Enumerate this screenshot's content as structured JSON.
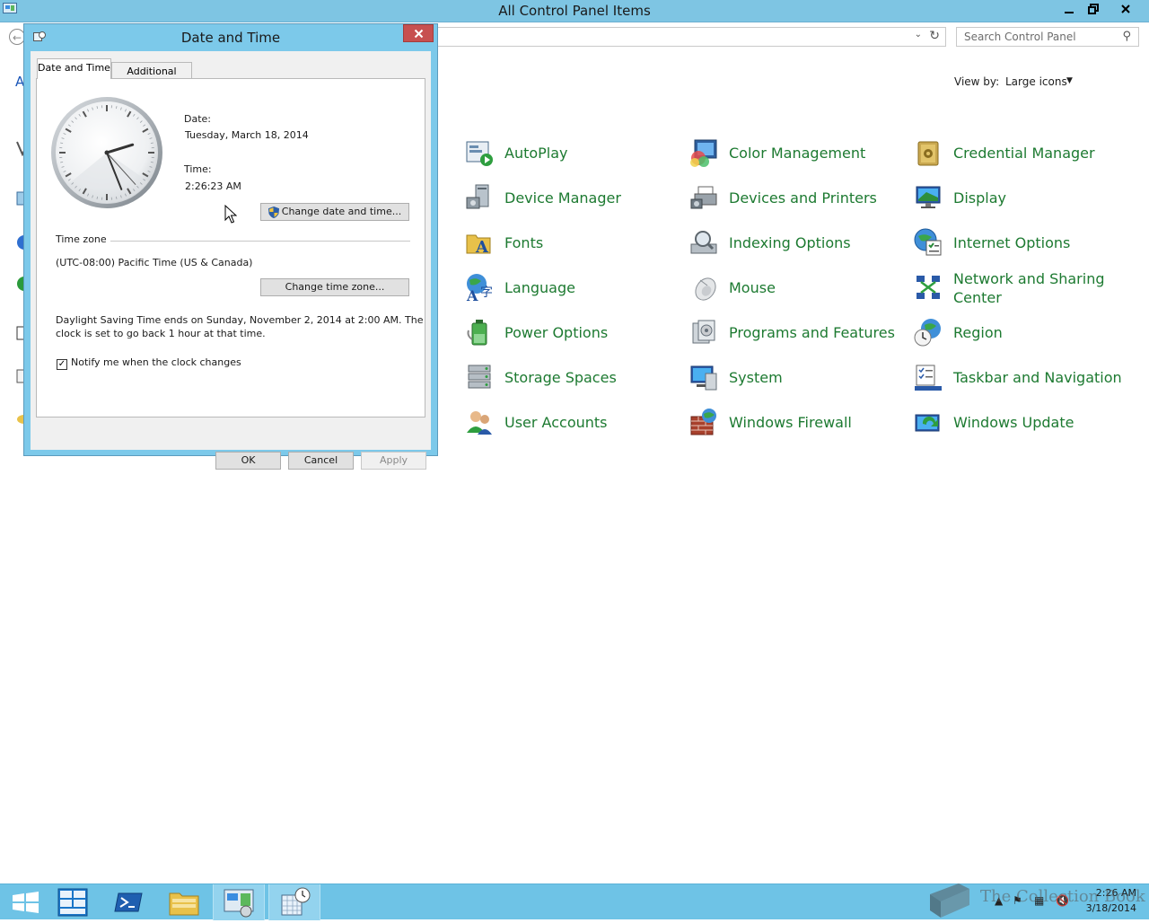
{
  "control_panel": {
    "window_title": "All Control Panel Items",
    "search_placeholder": "Search Control Panel",
    "view_by_label": "View by:",
    "view_by_value": "Large icons",
    "left_fragment_letter": "A",
    "items": [
      {
        "label": "AutoPlay",
        "icon": "autoplay-icon"
      },
      {
        "label": "Color Management",
        "icon": "color-management-icon"
      },
      {
        "label": "Credential Manager",
        "icon": "credential-manager-icon"
      },
      {
        "label": "Device Manager",
        "icon": "device-manager-icon"
      },
      {
        "label": "Devices and Printers",
        "icon": "devices-printers-icon"
      },
      {
        "label": "Display",
        "icon": "display-icon"
      },
      {
        "label": "Fonts",
        "icon": "fonts-icon"
      },
      {
        "label": "Indexing Options",
        "icon": "indexing-options-icon"
      },
      {
        "label": "Internet Options",
        "icon": "internet-options-icon"
      },
      {
        "label": "Language",
        "icon": "language-icon"
      },
      {
        "label": "Mouse",
        "icon": "mouse-icon"
      },
      {
        "label": "Network and Sharing Center",
        "icon": "network-sharing-icon"
      },
      {
        "label": "Power Options",
        "icon": "power-options-icon"
      },
      {
        "label": "Programs and Features",
        "icon": "programs-features-icon"
      },
      {
        "label": "Region",
        "icon": "region-icon"
      },
      {
        "label": "Storage Spaces",
        "icon": "storage-spaces-icon"
      },
      {
        "label": "System",
        "icon": "system-icon"
      },
      {
        "label": "Taskbar and Navigation",
        "icon": "taskbar-navigation-icon"
      },
      {
        "label": "User Accounts",
        "icon": "user-accounts-icon"
      },
      {
        "label": "Windows Firewall",
        "icon": "windows-firewall-icon"
      },
      {
        "label": "Windows Update",
        "icon": "windows-update-icon"
      }
    ]
  },
  "dialog": {
    "title": "Date and Time",
    "tabs": [
      "Date and Time",
      "Additional Clocks"
    ],
    "date_label": "Date:",
    "date_value": "Tuesday, March 18, 2014",
    "time_label": "Time:",
    "time_value": "2:26:23 AM",
    "change_dt_button": "Change date and time...",
    "timezone_heading": "Time zone",
    "timezone_value": "(UTC-08:00) Pacific Time (US & Canada)",
    "change_tz_button": "Change time zone...",
    "dst_line1": "Daylight Saving Time ends on Sunday, November 2, 2014 at 2:00 AM. The",
    "dst_line2": "clock is set to go back 1 hour at that time.",
    "notify_label": "Notify me when the clock changes",
    "notify_checked": true,
    "ok_button": "OK",
    "cancel_button": "Cancel",
    "apply_button": "Apply",
    "clock": {
      "hour": 2,
      "minute": 26,
      "second": 23
    }
  },
  "taskbar": {
    "time": "2:26 AM",
    "date": "3/18/2014",
    "watermark": "The Collection Book"
  },
  "colors": {
    "titlebar": "#7ec5e3",
    "link_green": "#1d7a31",
    "taskbar": "#6ec3e6"
  }
}
